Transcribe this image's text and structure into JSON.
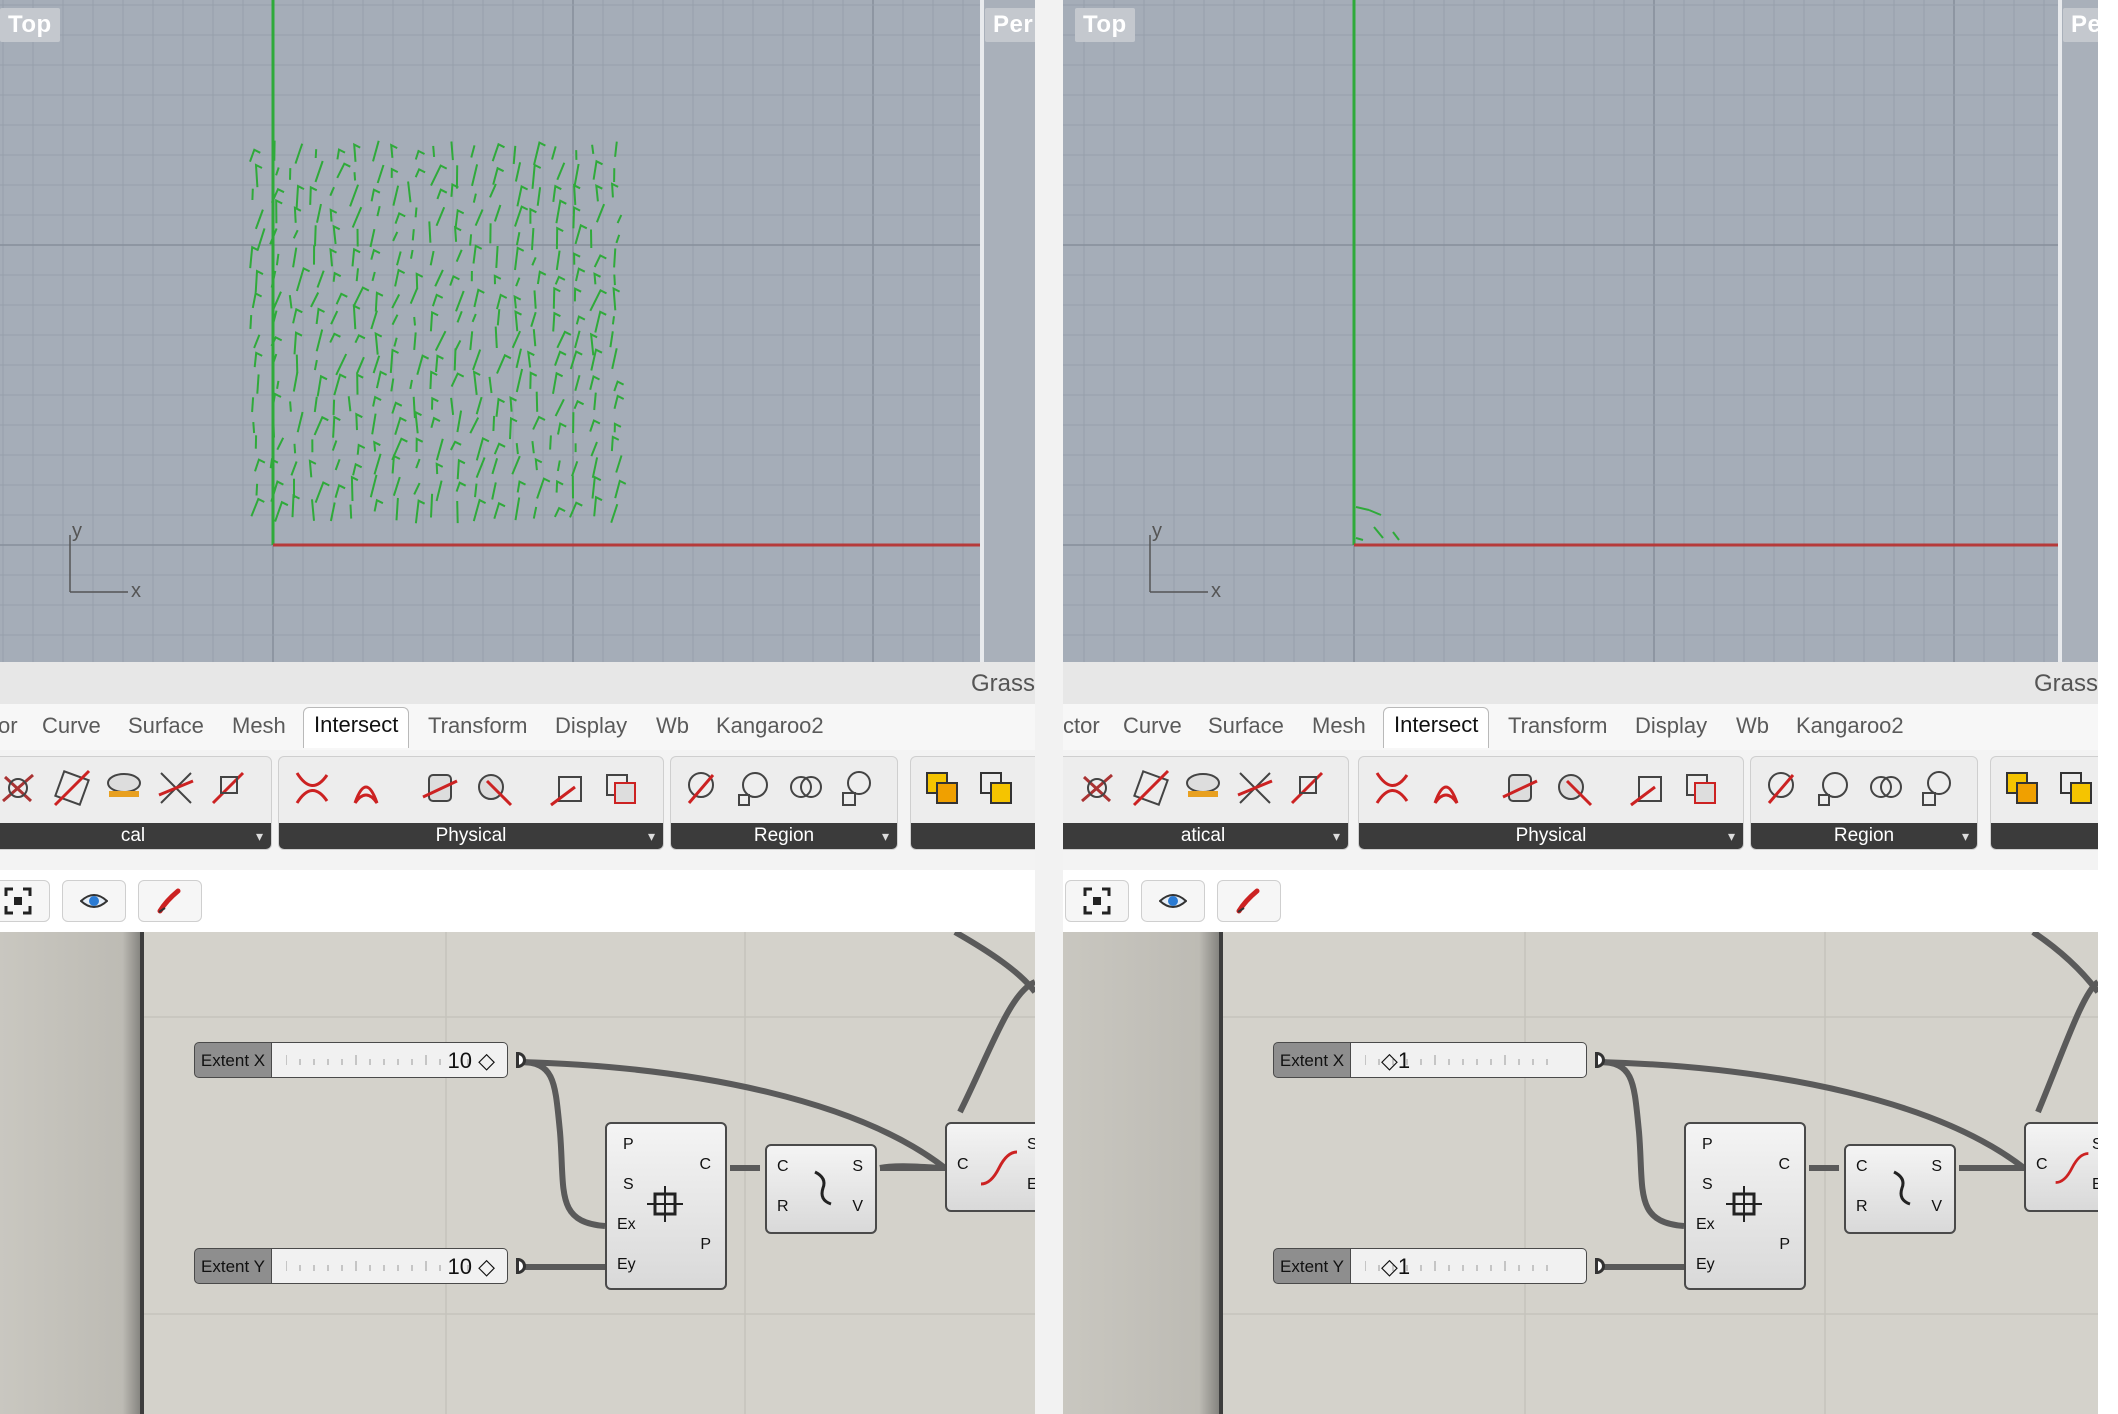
{
  "viewport": {
    "top_label": "Top",
    "persp_label": "Per",
    "axis_x": "x",
    "axis_y": "y"
  },
  "grasshopper": {
    "title": "Grass"
  },
  "panels": [
    {
      "tabs": [
        "or",
        "Curve",
        "Surface",
        "Mesh",
        "Intersect",
        "Transform",
        "Display",
        "Wb",
        "Kangaroo2"
      ],
      "active_tab": "Intersect",
      "groups": [
        "cal",
        "Physical",
        "Region",
        ""
      ],
      "extent_x_value": "10",
      "extent_y_value": "10"
    },
    {
      "tabs": [
        "ctor",
        "Curve",
        "Surface",
        "Mesh",
        "Intersect",
        "Transform",
        "Display",
        "Wb",
        "Kangaroo2"
      ],
      "active_tab": "Intersect",
      "groups": [
        "atical",
        "Physical",
        "Region",
        ""
      ],
      "extent_x_value": "1",
      "extent_y_value": "1"
    }
  ],
  "sliders": {
    "extent_x_label": "Extent X",
    "extent_y_label": "Extent Y"
  },
  "rectangle_component": {
    "inputs": [
      "P",
      "S",
      "Ex",
      "Ey"
    ],
    "outputs": [
      "C",
      "P"
    ]
  },
  "divide_component": {
    "inputs": [
      "C",
      "R"
    ],
    "outputs": [
      "S",
      "V"
    ]
  },
  "curve_component": {
    "inputs": [
      "C"
    ],
    "outputs": [
      "S",
      "E"
    ]
  },
  "icons": {
    "canvas_tools": [
      "zoom-extents-icon",
      "preview-eye-icon",
      "sketch-pen-icon"
    ]
  },
  "colors": {
    "viewport_bg": "#a5adb8",
    "curve_green": "#2faa3a",
    "x_axis_red": "#b63a3a",
    "y_axis_green": "#2faa3a",
    "canvas_bg": "#d4d2cb"
  }
}
